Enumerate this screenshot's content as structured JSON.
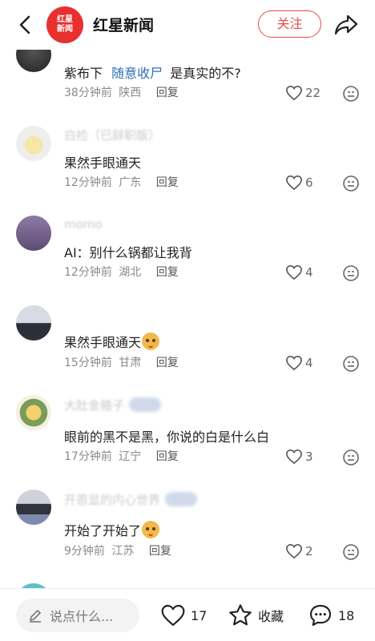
{
  "header": {
    "logo_text": "红星新闻",
    "title": "红星新闻",
    "follow_label": "关注"
  },
  "comments": [
    {
      "username": "",
      "content_prefix": "紫布下",
      "content_link": "随意收尸",
      "content_suffix": "是真实的不?",
      "time": "38分钟前",
      "region": "陕西",
      "reply_label": "回复",
      "likes": "22"
    },
    {
      "username": "白捡（已辞职版）",
      "content": "果然手眼通天",
      "time": "12分钟前",
      "region": "广东",
      "reply_label": "回复",
      "likes": "6"
    },
    {
      "username": "momo",
      "content": "AI：别什么锅都让我背",
      "time": "12分钟前",
      "region": "湖北",
      "reply_label": "回复",
      "likes": "4"
    },
    {
      "username": "",
      "content": "果然手眼通天",
      "time": "15分钟前",
      "region": "甘肃",
      "reply_label": "回复",
      "likes": "4"
    },
    {
      "username": "大肚金箍子",
      "content": "眼前的黑不是黑，你说的白是什么白",
      "time": "17分钟前",
      "region": "辽宁",
      "reply_label": "回复",
      "likes": "3"
    },
    {
      "username": "开恩显的内心世界",
      "content": "开始了开始了",
      "time": "9分钟前",
      "region": "江苏",
      "reply_label": "回复",
      "likes": "2"
    }
  ],
  "bottom_bar": {
    "input_placeholder": "说点什么...",
    "likes": "17",
    "collect_label": "收藏",
    "comments": "18"
  },
  "colors": {
    "brand_red": "#e8302f",
    "link_blue": "#2f6fb6",
    "text_gray": "#8a8a8a"
  },
  "icons": [
    "chevron-left-icon",
    "share-icon",
    "heart-icon",
    "more-icon",
    "pencil-icon",
    "star-icon",
    "comment-bubble-icon"
  ]
}
